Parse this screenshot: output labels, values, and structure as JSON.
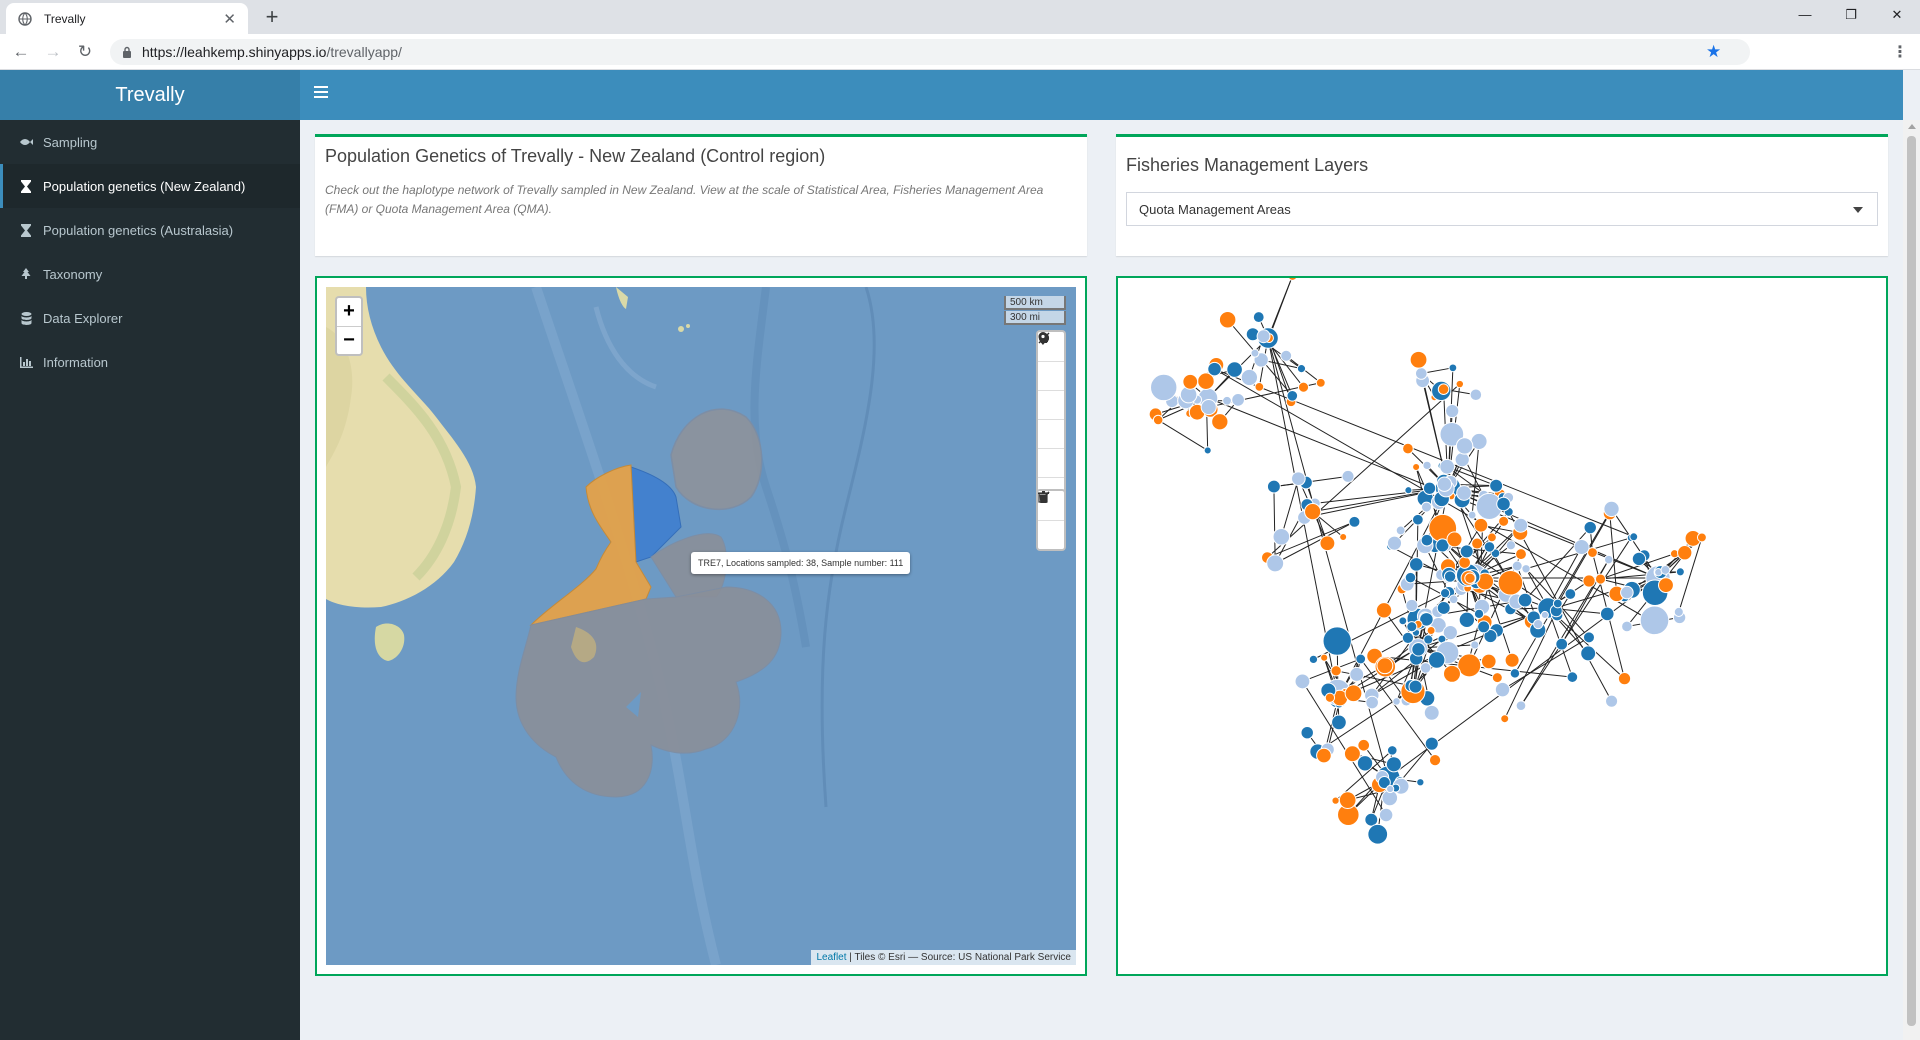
{
  "browser": {
    "tab_title": "Trevally",
    "url_host": "https://leahkemp.shinyapps.io",
    "url_path": "/trevallyapp/"
  },
  "app": {
    "title": "Trevally"
  },
  "sidebar": {
    "items": [
      {
        "label": "Sampling",
        "icon": "fish-icon",
        "active": false
      },
      {
        "label": "Population genetics (New Zealand)",
        "icon": "hourglass-icon",
        "active": true
      },
      {
        "label": "Population genetics (Australasia)",
        "icon": "hourglass-icon",
        "active": false
      },
      {
        "label": "Taxonomy",
        "icon": "tree-icon",
        "active": false
      },
      {
        "label": "Data Explorer",
        "icon": "database-icon",
        "active": false
      },
      {
        "label": "Information",
        "icon": "bar-chart-icon",
        "active": false
      }
    ]
  },
  "info_box": {
    "title": "Population Genetics of Trevally - New Zealand (Control region)",
    "description": "Check out the haplotype network of Trevally sampled in New Zealand. View at the scale of Statistical Area, Fisheries Management Area (FMA) or Quota Management Area (QMA)."
  },
  "layers_box": {
    "title": "Fisheries Management Layers",
    "selected": "Quota Management Areas"
  },
  "map": {
    "scale_km": "500 km",
    "scale_mi": "300 mi",
    "tooltip": "TRE7, Locations sampled: 38, Sample number: 111",
    "attribution_link": "Leaflet",
    "attribution_text": " | Tiles © Esri — Source: US National Park Service",
    "zoom_in": "+",
    "zoom_out": "−",
    "colors": {
      "ocean": "#6f9cc6",
      "land": "#e8dfb0",
      "qma_selected": "#e3a24a",
      "qma_blue": "#3f7fd0",
      "qma_grey": "#8a8f99"
    }
  },
  "network": {
    "colors": {
      "dark_blue": "#1f77b4",
      "orange": "#ff7f0e",
      "light_blue": "#aec7e8"
    }
  }
}
